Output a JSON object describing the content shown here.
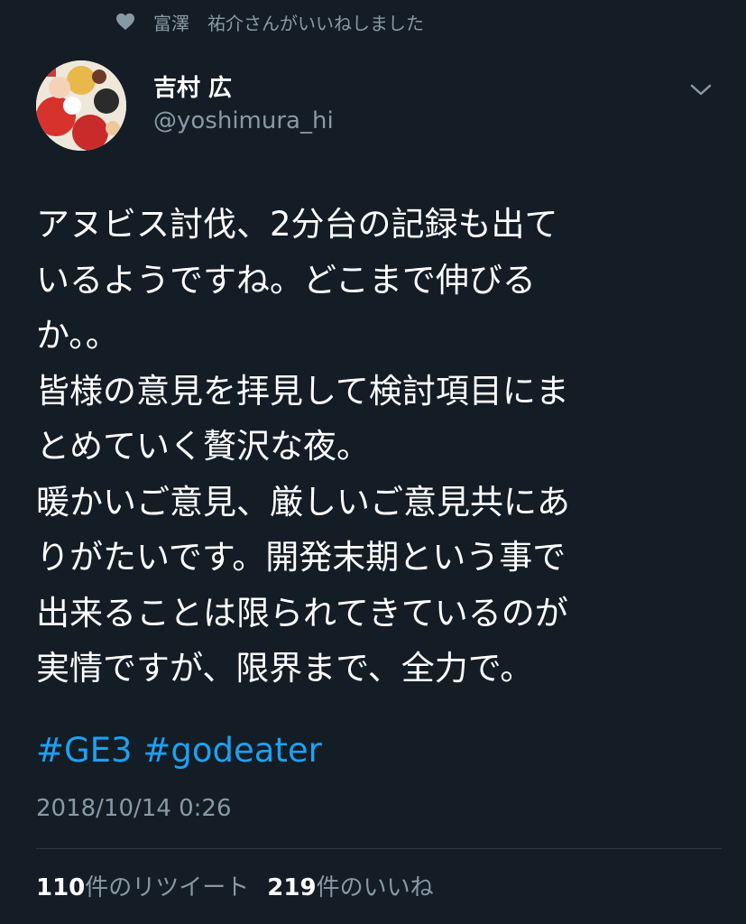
{
  "social_context": {
    "text": "富澤　祐介さんがいいねしました",
    "icon": "heart-icon"
  },
  "author": {
    "name": "吉村 広",
    "handle": "@yoshimura_hi"
  },
  "tweet": {
    "lines": [
      "アヌビス討伐、2分台の記録も出て",
      "いるようですね。どこまで伸びる",
      "か。。",
      "皆様の意見を拝見して検討項目にま",
      "とめていく贅沢な夜。",
      "暖かいご意見、厳しいご意見共にあ",
      "りがたいです。開発末期という事で",
      "出来ることは限られてきているのが",
      "実情ですが、限界まで、全力で。"
    ],
    "hashtags": [
      "#GE3",
      "#godeater"
    ]
  },
  "timestamp": "2018/10/14 0:26",
  "stats": {
    "retweets_count": "110",
    "retweets_label": "件のリツイート",
    "likes_count": "219",
    "likes_label": "件のいいね"
  },
  "colors": {
    "background": "#141d26",
    "secondary_text": "#8899a6",
    "link": "#1da1f2",
    "primary_text": "#ffffff"
  },
  "icons": [
    "heart-icon",
    "chevron-down-icon"
  ]
}
